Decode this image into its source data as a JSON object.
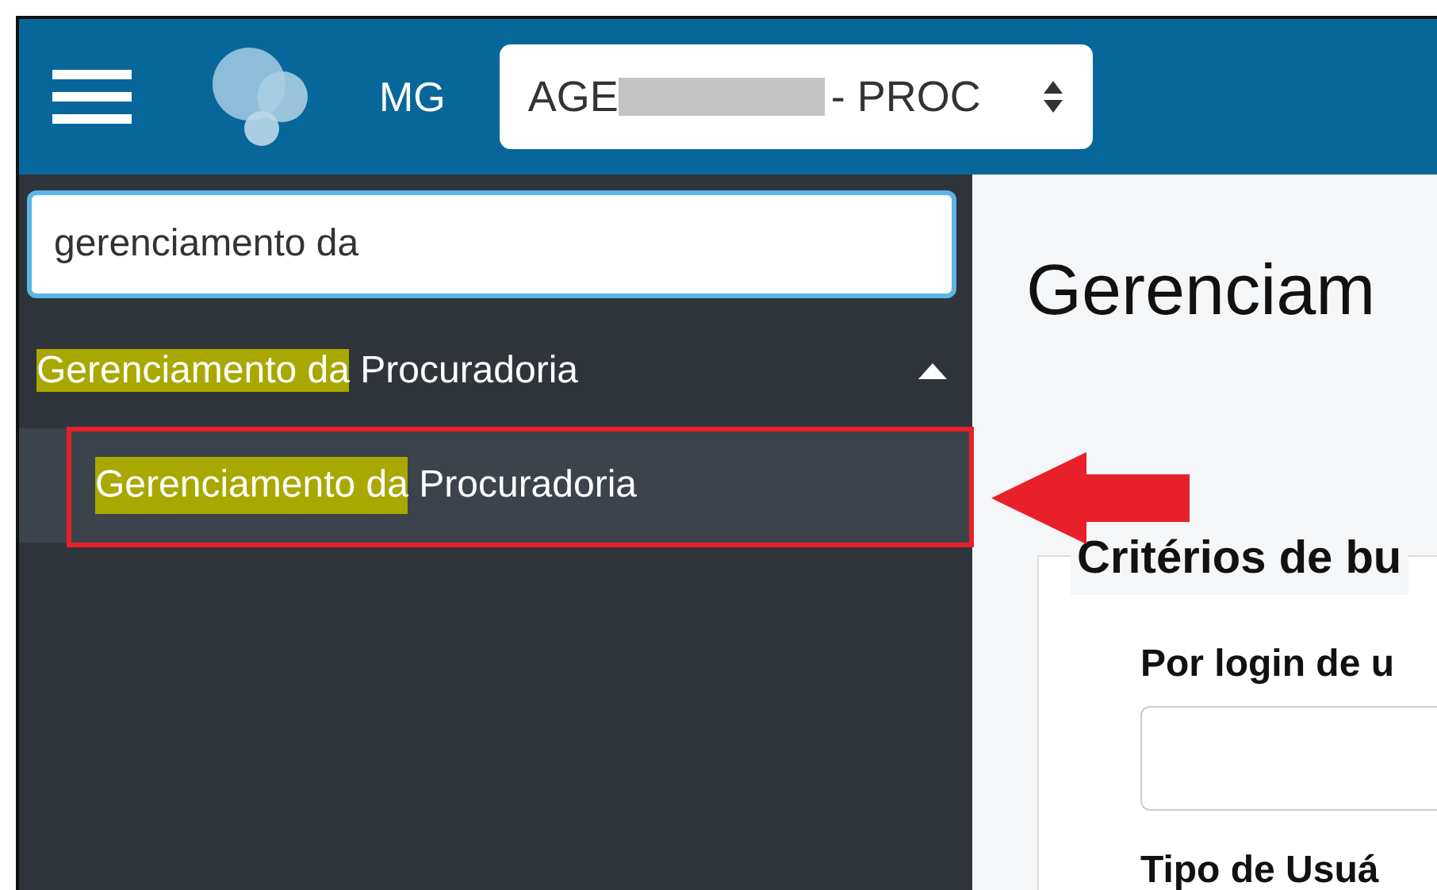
{
  "topbar": {
    "org_code": "MG",
    "unit_select": {
      "prefix": "AGE",
      "redacted": true,
      "suffix": "- PROC"
    }
  },
  "sidebar": {
    "search": {
      "value": "gerenciamento da"
    },
    "menu": [
      {
        "match": "Gerenciamento da",
        "rest": "Procuradoria",
        "expanded": true,
        "children": [
          {
            "match": "Gerenciamento da",
            "rest": "Procuradoria",
            "selected": true
          }
        ]
      }
    ]
  },
  "content": {
    "title": "Gerenciam",
    "fieldset": {
      "legend": "Critérios de bu",
      "fields": [
        {
          "label": "Por login de u",
          "kind": "text"
        },
        {
          "label": "Tipo de Usuá",
          "kind": "label"
        }
      ]
    }
  },
  "callout": {
    "color": "#e8202a"
  }
}
